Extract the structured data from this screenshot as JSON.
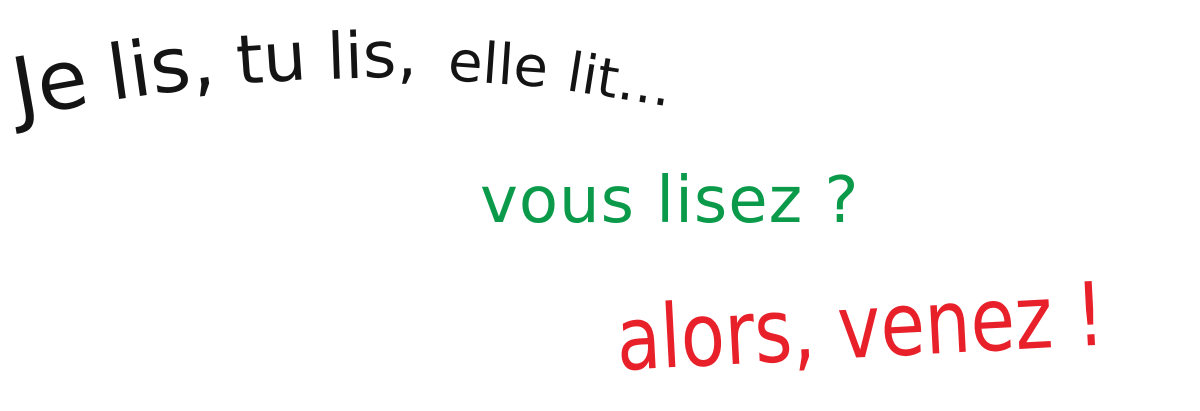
{
  "poster": {
    "line1": {
      "w1": "Je",
      "w2": "lis,",
      "w3": "tu",
      "w4": "lis,",
      "w5": "elle",
      "w6": "lit…"
    },
    "line2": {
      "text": "vous lisez ?",
      "color": "#0a9a4a"
    },
    "line3": {
      "text": "alors, venez !",
      "color": "#e8202a"
    }
  }
}
